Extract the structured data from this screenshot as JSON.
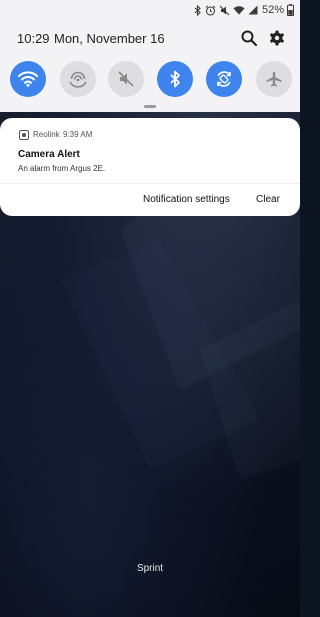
{
  "status_bar": {
    "battery_percent": "52%",
    "icons": [
      "bluetooth-icon",
      "alarm-icon",
      "mute-icon",
      "wifi-icon",
      "signal-icon",
      "battery-icon"
    ]
  },
  "header": {
    "time": "10:29",
    "date": "Mon, November 16",
    "icons": [
      "search-icon",
      "gear-icon"
    ]
  },
  "quick_settings": [
    {
      "name": "wifi",
      "state": "on"
    },
    {
      "name": "mobile-hotspot",
      "state": "off"
    },
    {
      "name": "sound-mute",
      "state": "off"
    },
    {
      "name": "bluetooth",
      "state": "on"
    },
    {
      "name": "auto-rotate",
      "state": "on"
    },
    {
      "name": "airplane-mode",
      "state": "off"
    }
  ],
  "colors": {
    "accent": "#3e84ec",
    "toggle_off": "#dedee2",
    "panel": "#f3f3f5"
  },
  "notification": {
    "app": "Reolink",
    "time": "9:39 AM",
    "title": "Camera Alert",
    "body": "An alarm from Argus 2E.",
    "actions": {
      "settings": "Notification settings",
      "clear": "Clear"
    }
  },
  "carrier": "Sprint"
}
